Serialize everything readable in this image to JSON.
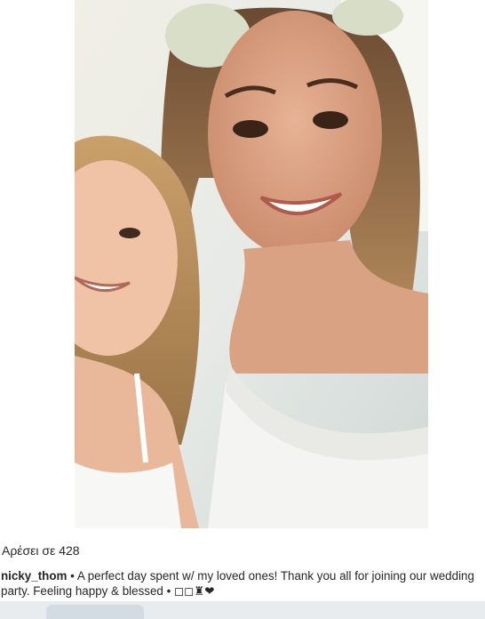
{
  "post": {
    "likes_text": "Αρέσει σε 428",
    "username": "nicky_thom",
    "caption_text": "• A perfect day spent w/ my loved ones! Thank you all for joining our wedding party. Feeling happy & blessed •",
    "emoji_text": "◻◻♜❤"
  }
}
